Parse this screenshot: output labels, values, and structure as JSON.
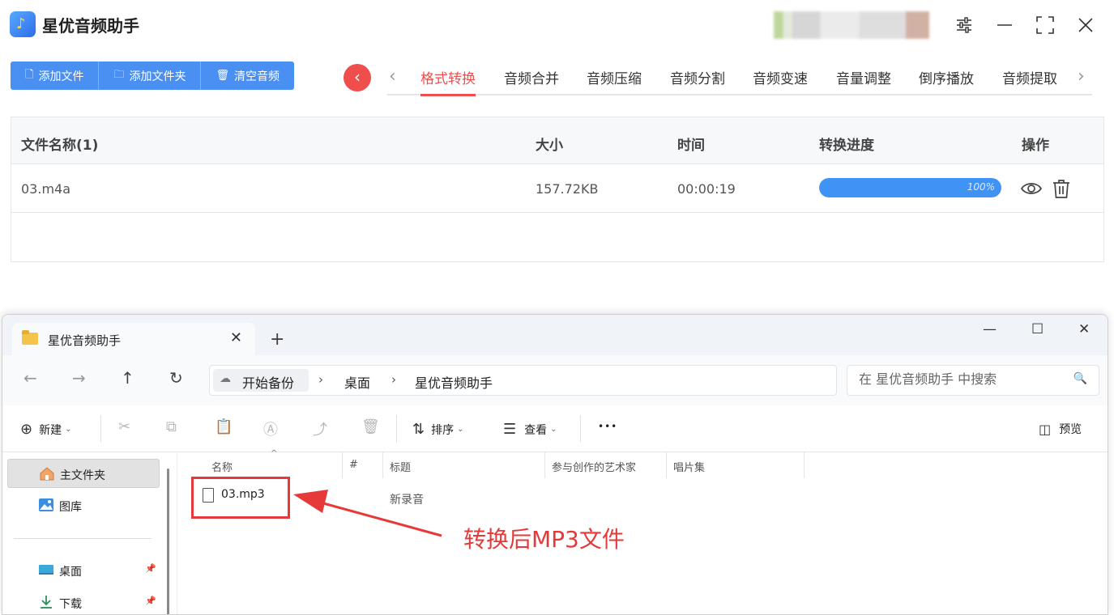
{
  "app": {
    "title": "星优音频助手",
    "toolbar": {
      "add_file": "添加文件",
      "add_folder": "添加文件夹",
      "clear": "清空音频"
    },
    "tabs": [
      "格式转换",
      "音频合并",
      "音频压缩",
      "音频分割",
      "音频变速",
      "音量调整",
      "倒序播放",
      "音频提取"
    ],
    "active_tab": "格式转换",
    "table": {
      "headers": {
        "name": "文件名称(1)",
        "size": "大小",
        "time": "时间",
        "progress": "转换进度",
        "actions": "操作"
      },
      "rows": [
        {
          "name": "03.m4a",
          "size": "157.72KB",
          "time": "00:00:19",
          "progress_text": "100%",
          "progress": 1.0
        }
      ]
    },
    "accent_color": "#4a90f2",
    "active_color": "#f04d4d"
  },
  "explorer": {
    "tab_label": "星优音频助手",
    "breadcrumb": [
      "开始备份",
      "桌面",
      "星优音频助手"
    ],
    "search_placeholder": "在 星优音频助手 中搜索",
    "commands": {
      "new": "新建",
      "sort": "排序",
      "view": "查看",
      "more": "•••",
      "preview": "预览"
    },
    "sidebar": [
      "主文件夹",
      "图库",
      "桌面",
      "下载"
    ],
    "columns": [
      "名称",
      "#",
      "标题",
      "参与创作的艺术家",
      "唱片集"
    ],
    "files": [
      {
        "name": "03.mp3",
        "title": "新录音"
      }
    ]
  },
  "annotation": {
    "text": "转换后MP3文件",
    "color": "#e63a3a"
  }
}
